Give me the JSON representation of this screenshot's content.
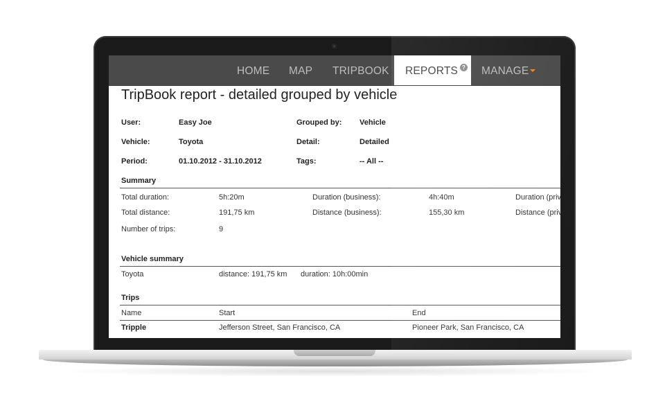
{
  "nav": {
    "home": "HOME",
    "map": "MAP",
    "tripbook": "TRIPBOOK",
    "reports": "REPORTS",
    "reports_badge": "?",
    "manage": "MANAGE"
  },
  "report": {
    "title": "TripBook report - detailed grouped by vehicle",
    "meta": {
      "user_label": "User:",
      "user_value": "Easy Joe",
      "grouped_label": "Grouped by:",
      "grouped_value": "Vehicle",
      "vehicle_label": "Vehicle:",
      "vehicle_value": "Toyota",
      "detail_label": "Detail:",
      "detail_value": "Detailed",
      "period_label": "Period:",
      "period_value": "01.10.2012 - 31.10.2012",
      "tags_label": "Tags:",
      "tags_value": "-- All --"
    },
    "summary": {
      "heading": "Summary",
      "total_duration_label": "Total duration:",
      "total_duration_value": "5h:20m",
      "duration_business_label": "Duration (business):",
      "duration_business_value": "4h:40m",
      "duration_private_label": "Duration (priv",
      "total_distance_label": "Total distance:",
      "total_distance_value": "191,75 km",
      "distance_business_label": "Distance (business):",
      "distance_business_value": "155,30 km",
      "distance_private_label": "Distance (priv",
      "trips_label": "Number of trips:",
      "trips_value": "9"
    },
    "vehicle_summary": {
      "heading": "Vehicle summary",
      "vehicle": "Toyota",
      "distance": "distance: 191,75 km",
      "duration": "duration: 10h:00min"
    },
    "trips": {
      "heading": "Trips",
      "columns": [
        "Name",
        "Start",
        "End"
      ],
      "rows": [
        {
          "name": "Tripple",
          "start": "Jefferson Street, San Francisco, CA",
          "end": "Pioneer Park, San Francisco, CA"
        }
      ]
    }
  }
}
